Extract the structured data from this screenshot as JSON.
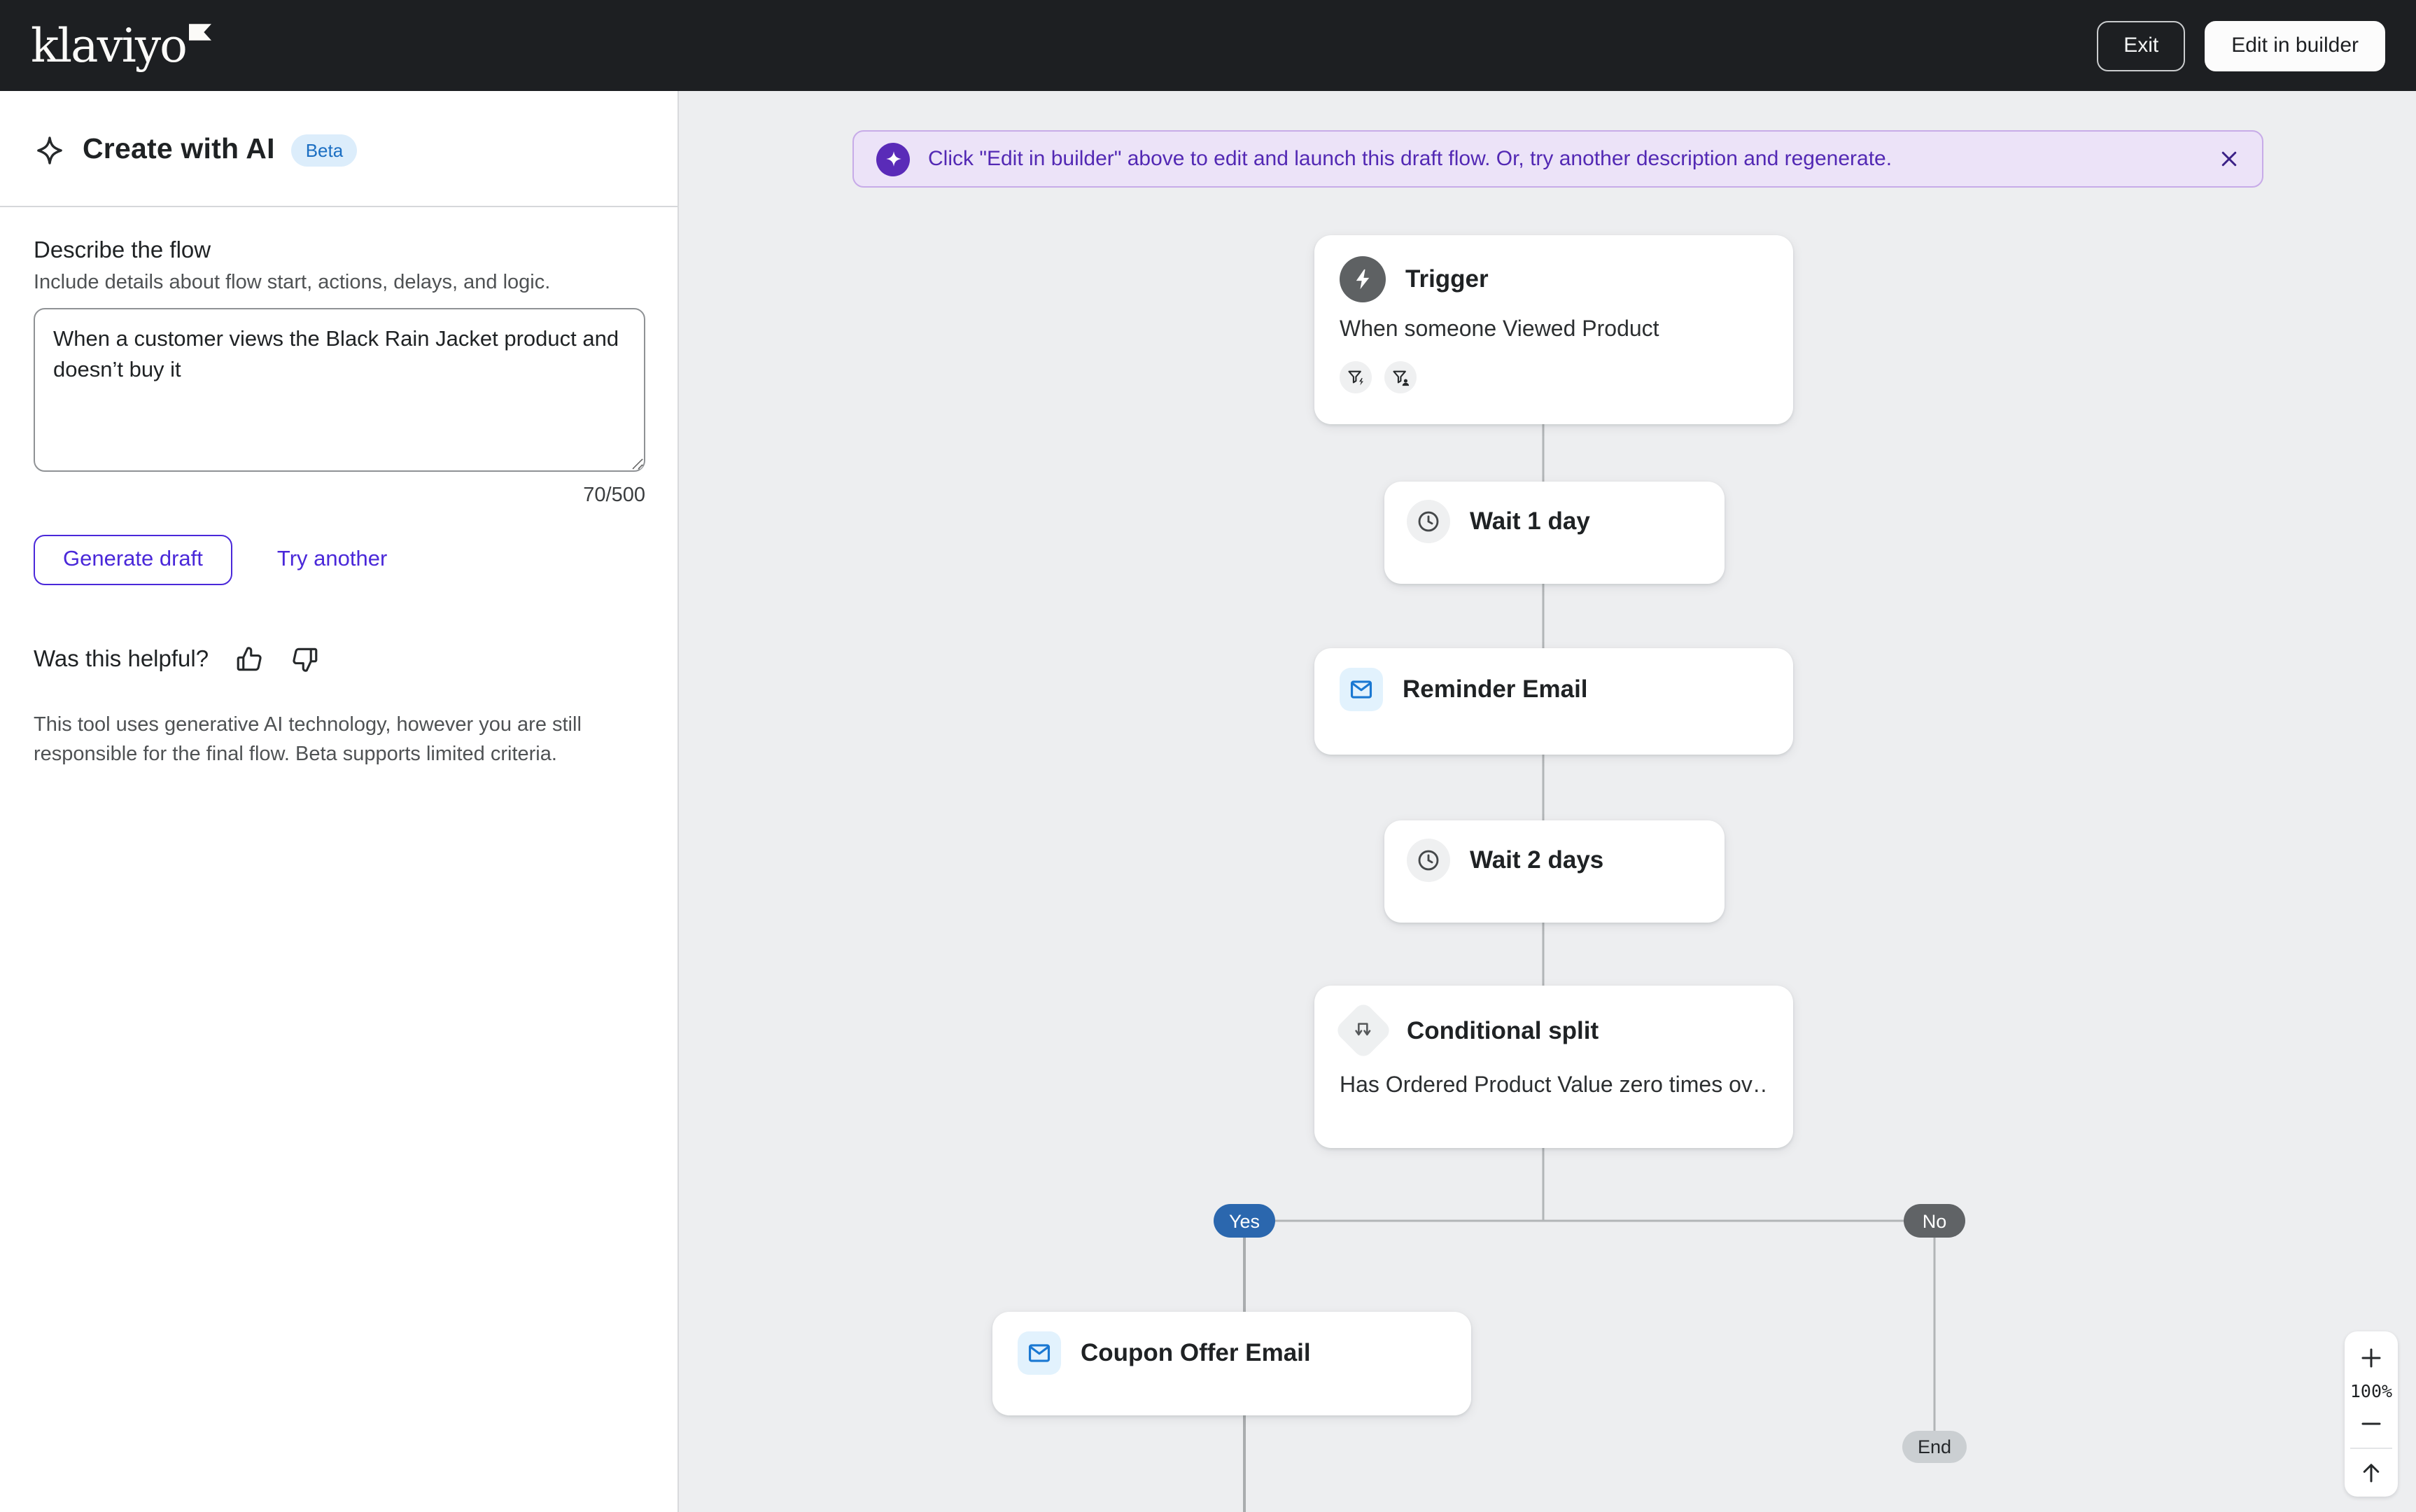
{
  "header": {
    "logo_text": "klaviyo",
    "exit_label": "Exit",
    "edit_in_builder_label": "Edit in builder"
  },
  "sidebar": {
    "title": "Create with AI",
    "beta_badge": "Beta",
    "describe_label": "Describe the flow",
    "describe_helper": "Include details about flow start, actions, delays, and logic.",
    "flow_description_value": "When a customer views the Black Rain Jacket product and doesn’t buy it",
    "char_counter": "70/500",
    "generate_button_label": "Generate draft",
    "try_another_label": "Try another",
    "feedback_question": "Was this helpful?",
    "disclaimer": "This tool uses generative AI technology, however you are still responsible for the final flow. Beta supports limited criteria."
  },
  "banner": {
    "message": "Click \"Edit in builder\" above to edit and launch this draft flow. Or, try another description and regenerate."
  },
  "flow": {
    "trigger_title": "Trigger",
    "trigger_body": "When someone Viewed Product",
    "wait1_title": "Wait 1 day",
    "reminder_title": "Reminder Email",
    "wait2_title": "Wait 2 days",
    "conditional_title": "Conditional split",
    "conditional_body": "Has Ordered Product Value zero times ov…",
    "yes_label": "Yes",
    "no_label": "No",
    "coupon_title": "Coupon Offer Email",
    "end_label": "End"
  },
  "zoom_controls": {
    "zoom_level": "100%"
  },
  "colors": {
    "accent_purple": "#4a28d9",
    "banner_purple": "#5329b4",
    "header_dark": "#1d1f22",
    "yes_blue": "#2b67ae",
    "no_gray": "#606366",
    "canvas_bg": "#edeef0"
  }
}
